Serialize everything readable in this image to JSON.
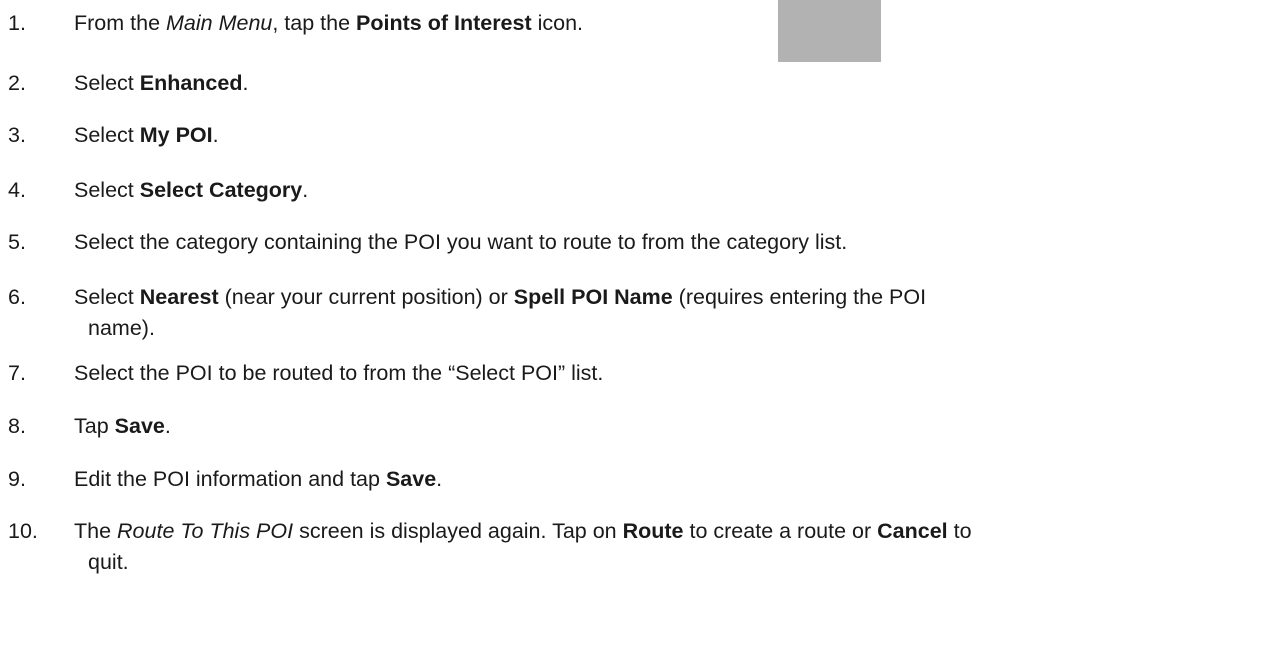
{
  "steps": [
    {
      "num": "1.",
      "parts": [
        {
          "t": "From the ",
          "s": "normal"
        },
        {
          "t": "Main Menu",
          "s": "italic"
        },
        {
          "t": ", tap the ",
          "s": "normal"
        },
        {
          "t": "Points of Interest",
          "s": "bold"
        },
        {
          "t": " icon.",
          "s": "normal"
        }
      ]
    },
    {
      "num": "2.",
      "parts": [
        {
          "t": "Select ",
          "s": "normal"
        },
        {
          "t": "Enhanced",
          "s": "bold"
        },
        {
          "t": ".",
          "s": "normal"
        }
      ]
    },
    {
      "num": "3.",
      "parts": [
        {
          "t": "Select ",
          "s": "normal"
        },
        {
          "t": "My POI",
          "s": "bold"
        },
        {
          "t": ".",
          "s": "normal"
        }
      ]
    },
    {
      "num": "4.",
      "parts": [
        {
          "t": "Select ",
          "s": "normal"
        },
        {
          "t": "Select Category",
          "s": "bold"
        },
        {
          "t": ".",
          "s": "normal"
        }
      ]
    },
    {
      "num": "5.",
      "parts": [
        {
          "t": "Select the category containing the POI you want to route to from the category list.",
          "s": "normal"
        }
      ]
    },
    {
      "num": "6.",
      "parts": [
        {
          "t": "Select ",
          "s": "normal"
        },
        {
          "t": "Nearest",
          "s": "bold"
        },
        {
          "t": " (near your current position) or ",
          "s": "normal"
        },
        {
          "t": "Spell POI Name",
          "s": "bold"
        },
        {
          "t": " (requires entering the POI",
          "s": "normal"
        }
      ],
      "cont": "name)."
    },
    {
      "num": "7.",
      "parts": [
        {
          "t": "Select the POI to be routed to from the “Select POI” list.",
          "s": "normal"
        }
      ]
    },
    {
      "num": "8.",
      "parts": [
        {
          "t": "Tap ",
          "s": "normal"
        },
        {
          "t": "Save",
          "s": "bold"
        },
        {
          "t": ".",
          "s": "normal"
        }
      ]
    },
    {
      "num": "9.",
      "parts": [
        {
          "t": "Edit the POI information and tap ",
          "s": "normal"
        },
        {
          "t": "Save",
          "s": "bold"
        },
        {
          "t": ".",
          "s": "normal"
        }
      ]
    },
    {
      "num": "10.",
      "parts": [
        {
          "t": "The ",
          "s": "normal"
        },
        {
          "t": "Route To This POI",
          "s": "italic"
        },
        {
          "t": " screen is displayed again.  Tap on ",
          "s": "normal"
        },
        {
          "t": "Route",
          "s": "bold"
        },
        {
          "t": " to create a route or ",
          "s": "normal"
        },
        {
          "t": "Cancel",
          "s": "bold"
        },
        {
          "t": " to",
          "s": "normal"
        }
      ],
      "cont": "quit."
    }
  ],
  "icon": {
    "name": "points-of-interest-icon",
    "color": "#b2b2b2"
  }
}
